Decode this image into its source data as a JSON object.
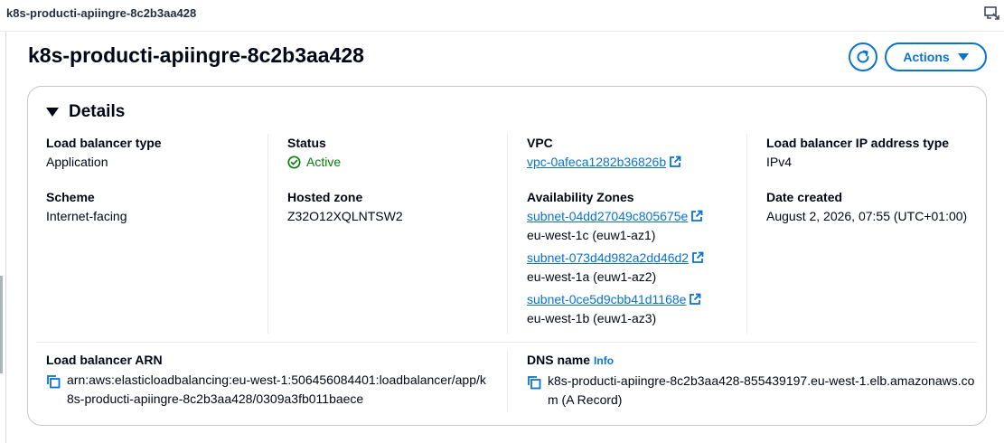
{
  "window": {
    "tab_title": "k8s-producti-apiingre-8c2b3aa428",
    "window_icon": "window-restore-icon"
  },
  "header": {
    "title": "k8s-producti-apiingre-8c2b3aa428",
    "refresh_icon": "refresh-icon",
    "actions_label": "Actions"
  },
  "details": {
    "heading": "Details",
    "load_balancer_type": {
      "label": "Load balancer type",
      "value": "Application"
    },
    "scheme": {
      "label": "Scheme",
      "value": "Internet-facing"
    },
    "status": {
      "label": "Status",
      "value": "Active",
      "color": "#037f0c",
      "icon": "status-success-icon"
    },
    "hosted_zone": {
      "label": "Hosted zone",
      "value": "Z32O12XQLNTSW2"
    },
    "vpc": {
      "label": "VPC",
      "value": "vpc-0afeca1282b36826b"
    },
    "availability_zones": {
      "label": "Availability Zones",
      "items": [
        {
          "subnet": "subnet-04dd27049c805675e",
          "zone": "eu-west-1c (euw1-az1)"
        },
        {
          "subnet": "subnet-073d4d982a2dd46d2",
          "zone": "eu-west-1a (euw1-az2)"
        },
        {
          "subnet": "subnet-0ce5d9cbb41d1168e",
          "zone": "eu-west-1b (euw1-az3)"
        }
      ]
    },
    "ip_address_type": {
      "label": "Load balancer IP address type",
      "value": "IPv4"
    },
    "date_created": {
      "label": "Date created",
      "value": "August 2, 2026, 07:55 (UTC+01:00)"
    },
    "arn": {
      "label": "Load balancer ARN",
      "value": "arn:aws:elasticloadbalancing:eu-west-1:506456084401:loadbalancer/app/k8s-producti-apiingre-8c2b3aa428/0309a3fb011baece"
    },
    "dns_name": {
      "label": "DNS name",
      "info_label": "Info",
      "value": "k8s-producti-apiingre-8c2b3aa428-855439197.eu-west-1.elb.amazonaws.com (A Record)"
    }
  },
  "colors": {
    "link": "#0972d3",
    "text": "#000716",
    "border": "#c6c6cd",
    "success": "#037f0c"
  }
}
